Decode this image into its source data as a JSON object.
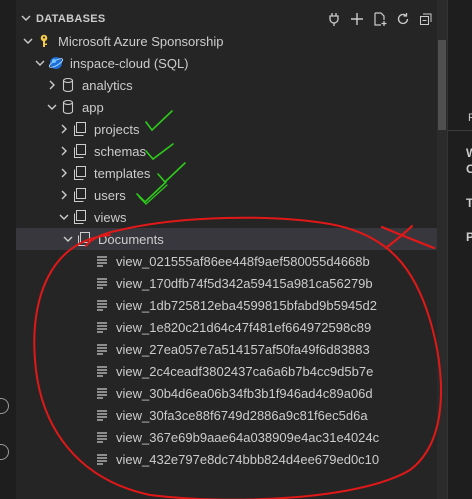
{
  "header": {
    "title": "DATABASES"
  },
  "toolbar": {
    "icons": [
      "plug-icon",
      "add-icon",
      "new-file-icon",
      "refresh-icon",
      "collapse-all-icon"
    ]
  },
  "tree": {
    "account": "Microsoft Azure Sponsorship",
    "server": "inspace-cloud (SQL)",
    "db1": "analytics",
    "db2": "app",
    "collections": [
      "projects",
      "schemas",
      "templates",
      "users",
      "views"
    ],
    "selected": "Documents",
    "documents": [
      "view_021555af86ee448f9aef580055d4668b",
      "view_170dfb74f5d342a59415a981ca56279b",
      "view_1db725812eba4599815bfabd9b5945d2",
      "view_1e820c21d64c47f481ef664972598c89",
      "view_27ea057e7a514157af50fa49f6d83883",
      "view_2c4ceadf3802437ca6a6b7b4cc9d5b7e",
      "view_30b4d6ea06b34fb3b1f946ad4c89a06d",
      "view_30fa3ce88f6749d2886a9c81f6ec5d6a",
      "view_367e69b9aae64a038909e4ac31e4024c",
      "view_432e797e8dc74bbb824d4ee679ed0c10"
    ]
  },
  "right_pane": {
    "letters": [
      "P",
      "W",
      "C",
      "T",
      "P"
    ]
  },
  "colors": {
    "annotation_green": "#2ecc1a",
    "annotation_red": "#e01818",
    "selection": "#37373d",
    "cosmos_blue": "#3fa0ff",
    "key_gold": "#f2c94c"
  }
}
